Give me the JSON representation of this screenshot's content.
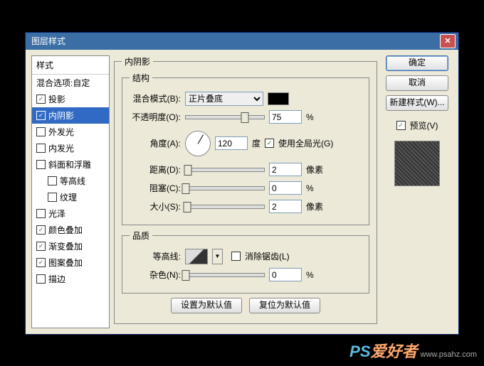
{
  "window": {
    "title": "图层样式"
  },
  "sidebar": {
    "header": "样式",
    "blending": "混合选项:自定",
    "items": [
      {
        "label": "投影",
        "checked": true
      },
      {
        "label": "内阴影",
        "checked": true,
        "selected": true
      },
      {
        "label": "外发光",
        "checked": false
      },
      {
        "label": "内发光",
        "checked": false
      },
      {
        "label": "斜面和浮雕",
        "checked": false
      },
      {
        "label": "等高线",
        "checked": false,
        "indent": true
      },
      {
        "label": "纹理",
        "checked": false,
        "indent": true
      },
      {
        "label": "光泽",
        "checked": false
      },
      {
        "label": "颜色叠加",
        "checked": true
      },
      {
        "label": "渐变叠加",
        "checked": true
      },
      {
        "label": "图案叠加",
        "checked": true
      },
      {
        "label": "描边",
        "checked": false
      }
    ]
  },
  "main": {
    "group_title": "内阴影",
    "structure_title": "结构",
    "blend_mode_label": "混合模式(B):",
    "blend_mode_value": "正片叠底",
    "opacity_label": "不透明度(O):",
    "opacity_value": "75",
    "angle_label": "角度(A):",
    "angle_value": "120",
    "angle_unit": "度",
    "global_light": "使用全局光(G)",
    "distance_label": "距离(D):",
    "distance_value": "2",
    "distance_unit": "像素",
    "choke_label": "阻塞(C):",
    "choke_value": "0",
    "size_label": "大小(S):",
    "size_value": "2",
    "size_unit": "像素",
    "quality_title": "品质",
    "contour_label": "等高线:",
    "antialias": "消除锯齿(L)",
    "noise_label": "杂色(N):",
    "noise_value": "0",
    "percent": "%",
    "default_set": "设置为默认值",
    "default_reset": "复位为默认值"
  },
  "right": {
    "ok": "确定",
    "cancel": "取消",
    "new_style": "新建样式(W)...",
    "preview_label": "预览(V)"
  },
  "watermark": {
    "ps": "PS",
    "site": "爱好者",
    "url": "www.psahz.com"
  }
}
